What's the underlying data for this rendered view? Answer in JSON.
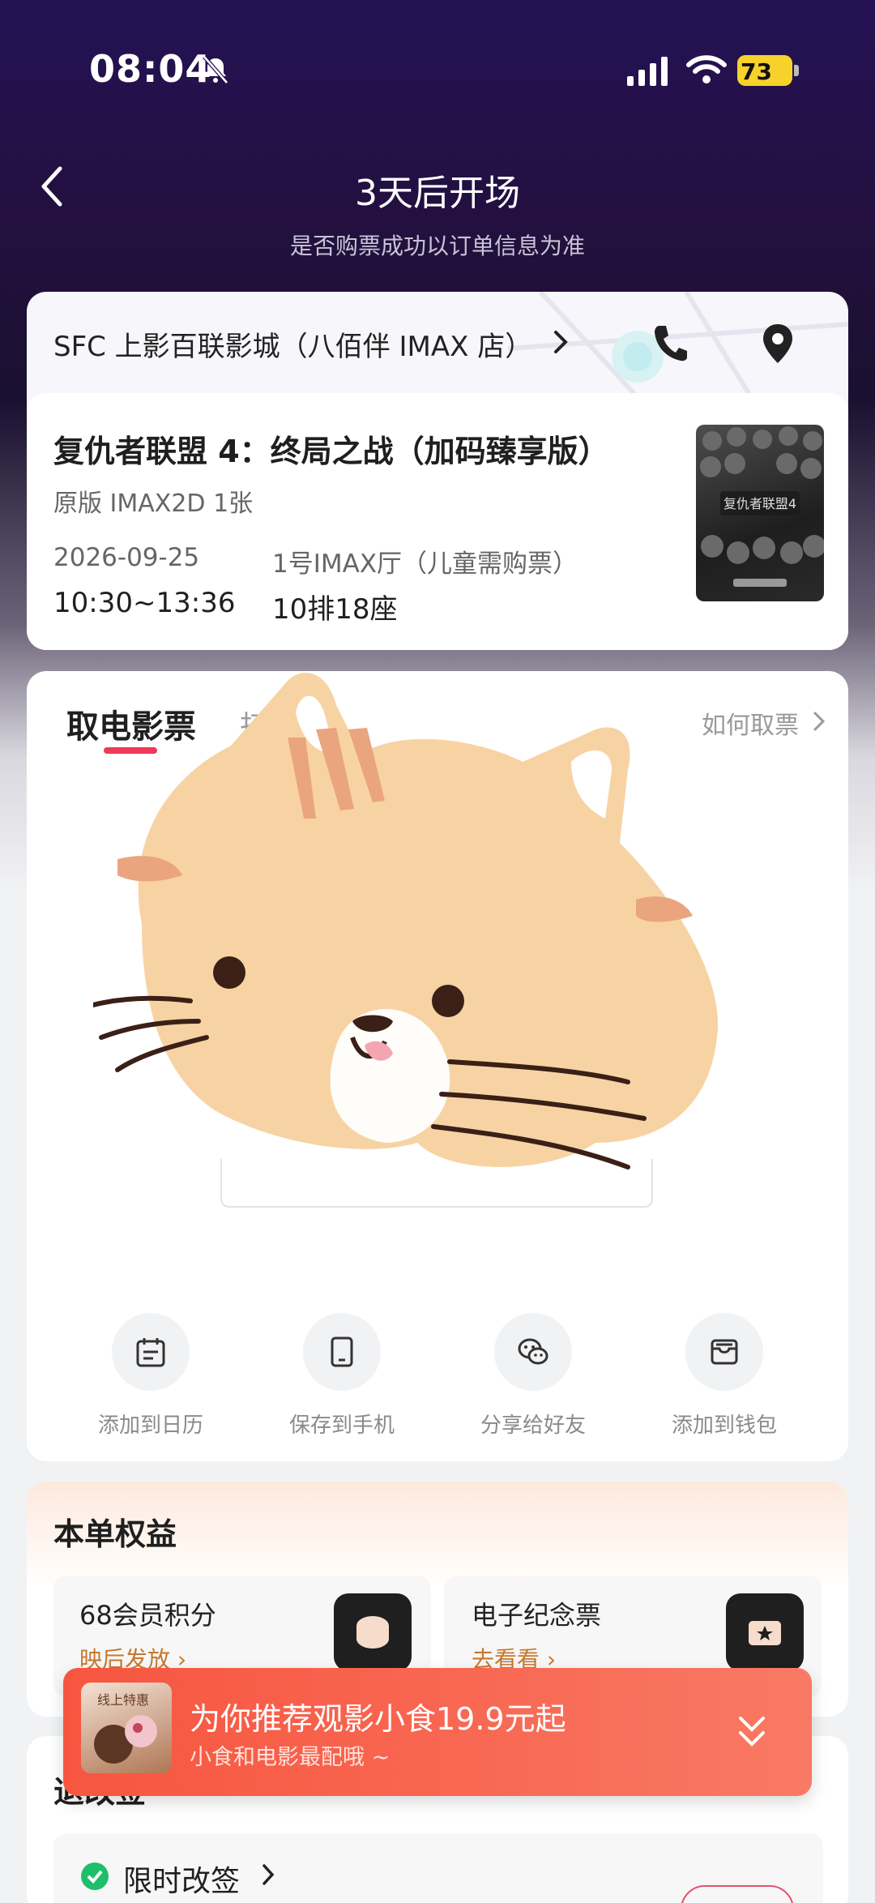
{
  "status_bar": {
    "time": "08:04",
    "battery": "73",
    "icons": [
      "bell-slash-icon",
      "signal-icon",
      "wifi-icon",
      "battery-charging-icon"
    ]
  },
  "header": {
    "title": "3天后开场",
    "subtitle": "是否购票成功以订单信息为准"
  },
  "cinema": {
    "name": "SFC 上影百联影城（八佰伴 IMAX 店）"
  },
  "movie": {
    "title": "复仇者联盟 4：终局之战（加码臻享版）",
    "spec": "原版 IMAX2D 1张",
    "date": "2026-09-25",
    "hall": "1号IMAX厅（儿童需购票）",
    "time": "10:30~13:36",
    "seat": "10排18座"
  },
  "ticket": {
    "tab_active": "取电影票",
    "tab_2": "扫码",
    "how_link": "如何取票",
    "actions": [
      {
        "label": "添加到日历",
        "icon": "calendar-icon"
      },
      {
        "label": "保存到手机",
        "icon": "phone-save-icon"
      },
      {
        "label": "分享给好友",
        "icon": "wechat-icon"
      },
      {
        "label": "添加到钱包",
        "icon": "wallet-icon"
      }
    ]
  },
  "benefits": {
    "title": "本单权益",
    "items": [
      {
        "title": "68会员积分",
        "link": "映后发放",
        "icon": "points-icon"
      },
      {
        "title": "电子纪念票",
        "link": "去看看",
        "icon": "ticket-star-icon"
      }
    ]
  },
  "change": {
    "title_visible": "退改签",
    "row_label": "限时改签"
  },
  "promo": {
    "thumb_text": "线上特惠",
    "title": "为你推荐观影小食19.9元起",
    "subtitle": "小食和电影最配哦 ~"
  },
  "colors": {
    "accent": "#ee3a57",
    "promo": "#f7553f",
    "benefit_link": "#c7782e",
    "battery": "#f6d22b"
  }
}
